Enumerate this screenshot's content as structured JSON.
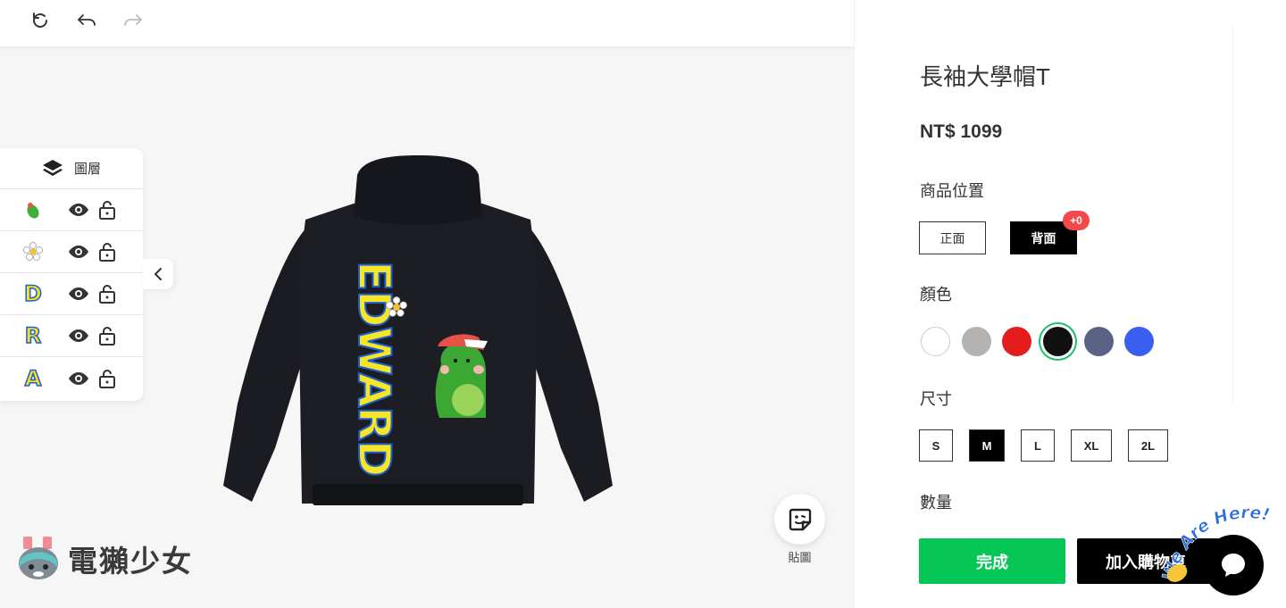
{
  "toolbar": {
    "reset_icon": "refresh-icon",
    "undo_icon": "undo-icon",
    "redo_icon": "redo-icon"
  },
  "layers": {
    "title": "圖層",
    "items": [
      {
        "thumb": "",
        "thumb_icon": "dino-sticker-icon"
      },
      {
        "thumb": "",
        "thumb_icon": "flower-sticker-icon"
      },
      {
        "thumb": "D"
      },
      {
        "thumb": "R"
      },
      {
        "thumb": "A"
      }
    ]
  },
  "design": {
    "text": "EDWARD",
    "text_color": "#f7e625",
    "outline_color": "#1f5fd6"
  },
  "sticker": {
    "label": "貼圖"
  },
  "watermark": {
    "text": "電獺少女"
  },
  "product": {
    "title": "長袖大學帽T",
    "price": "NT$ 1099",
    "position_label": "商品位置",
    "positions": [
      {
        "label": "正面",
        "active": false
      },
      {
        "label": "背面",
        "active": true
      }
    ],
    "position_badge": "+0",
    "color_label": "顏色",
    "colors": [
      {
        "hex": "#ffffff",
        "selected": false
      },
      {
        "hex": "#b4b3b2",
        "selected": false
      },
      {
        "hex": "#e51c1c",
        "selected": false
      },
      {
        "hex": "#111111",
        "selected": true
      },
      {
        "hex": "#5c6285",
        "selected": false
      },
      {
        "hex": "#3a5ff0",
        "selected": false
      }
    ],
    "size_label": "尺寸",
    "sizes": [
      {
        "label": "S",
        "active": false
      },
      {
        "label": "M",
        "active": true
      },
      {
        "label": "L",
        "active": false
      },
      {
        "label": "XL",
        "active": false
      },
      {
        "label": "2L",
        "active": false
      }
    ],
    "quantity_label": "數量",
    "done_label": "完成",
    "cart_label": "加入購物車"
  },
  "chat": {
    "badge_text": "We Are Here!",
    "accent": "#06c755"
  }
}
